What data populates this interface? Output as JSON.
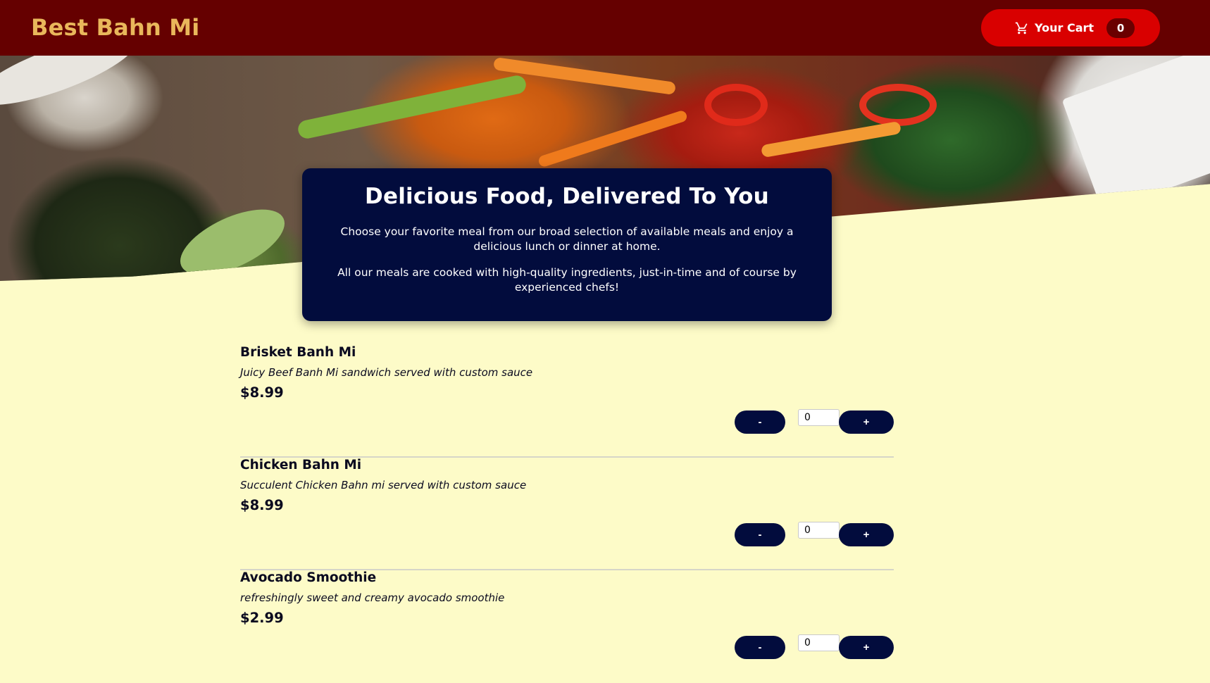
{
  "header": {
    "brand": "Best Bahn Mi",
    "cart_label": "Your Cart",
    "cart_count": "0",
    "colors": {
      "background": "#650000",
      "brand": "#e9b75b",
      "cart_button": "#d90000",
      "cart_badge": "#6a0000"
    },
    "cart_icon": "shopping-cart-icon"
  },
  "intro": {
    "title": "Delicious Food, Delivered To You",
    "paragraph_1": "Choose your favorite meal from our broad selection of available meals and enjoy a delicious lunch or dinner at home.",
    "paragraph_2": "All our meals are cooked with high-quality ingredients, just-in-time and of course by experienced chefs!",
    "background_color": "#020c3d"
  },
  "meals": [
    {
      "name": "Brisket Banh Mi",
      "description": "Juicy Beef Banh Mi sandwich served with custom sauce",
      "price": "$8.99",
      "minus_label": "-",
      "plus_label": "+",
      "quantity": "0"
    },
    {
      "name": "Chicken Bahn Mi",
      "description": "Succulent Chicken Bahn mi served with custom sauce",
      "price": "$8.99",
      "minus_label": "-",
      "plus_label": "+",
      "quantity": "0"
    },
    {
      "name": "Avocado Smoothie",
      "description": "refreshingly sweet and creamy avocado smoothie",
      "price": "$2.99",
      "minus_label": "-",
      "plus_label": "+",
      "quantity": "0"
    }
  ],
  "page_background": "#fdfbc8"
}
